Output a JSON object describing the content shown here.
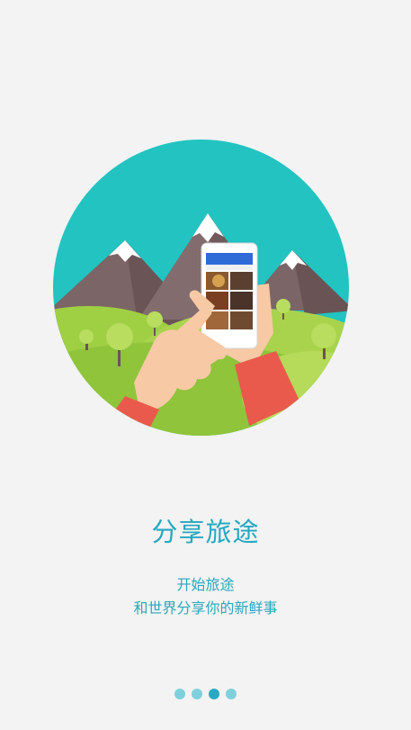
{
  "intro": {
    "title": "分享旅途",
    "subtitle_line1": "开始旅途",
    "subtitle_line2": "和世界分享你的新鲜事"
  },
  "pager": {
    "page_count": 4,
    "active_index": 2,
    "active_color": "#29a9c1",
    "inactive_color": "#7fd0dc"
  },
  "colors": {
    "background": "#f3f3f3",
    "circle": "#22c3c0",
    "title": "#25a8c0"
  },
  "icons": [
    "mountain-hand-phone-illustration"
  ]
}
